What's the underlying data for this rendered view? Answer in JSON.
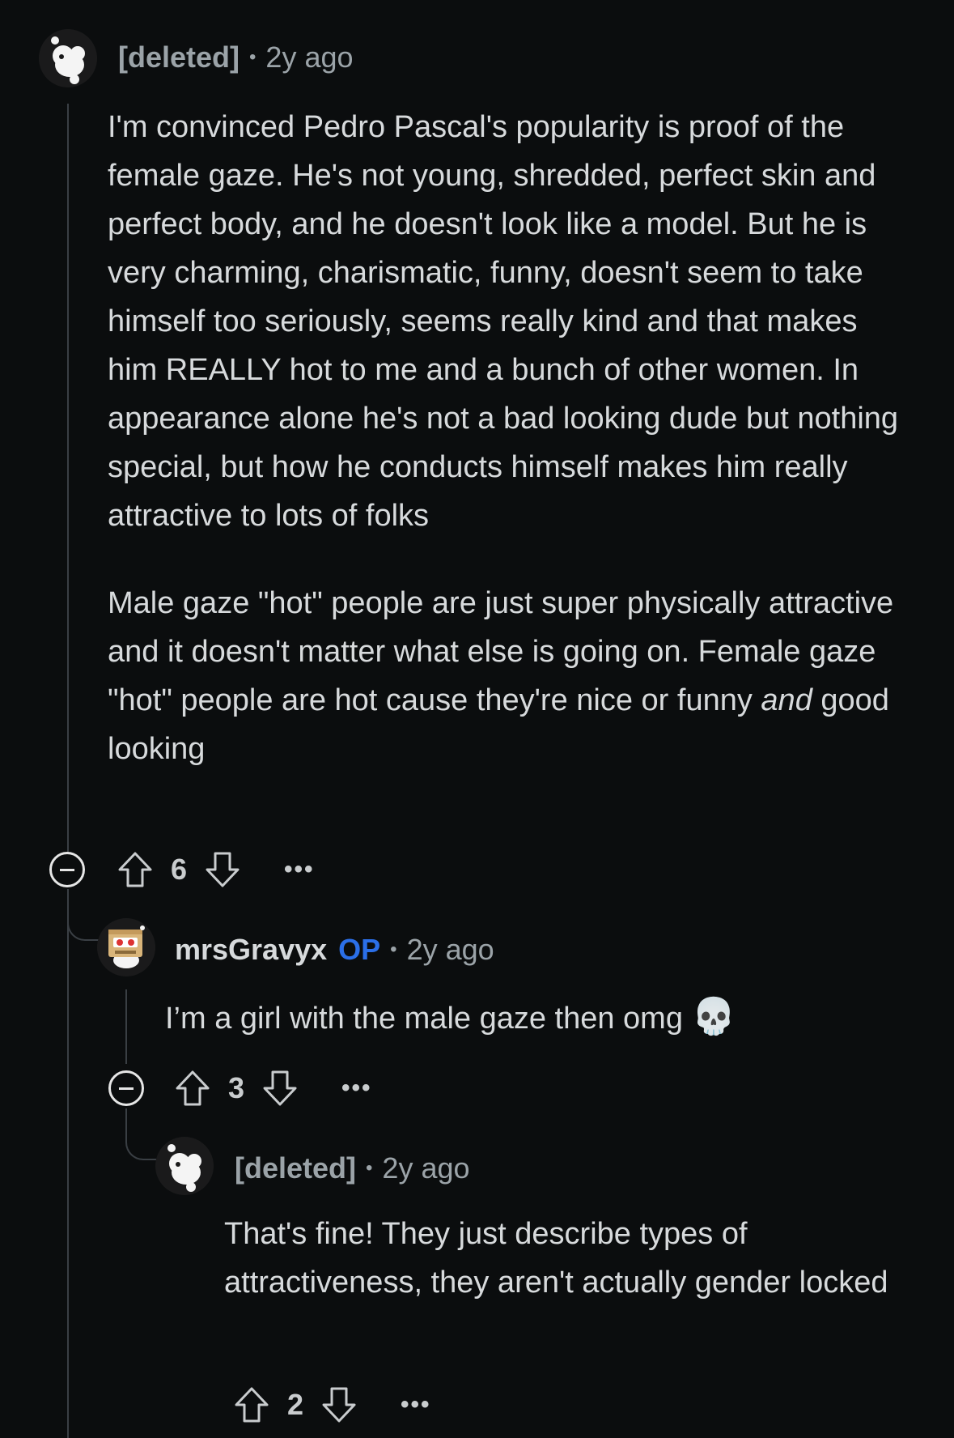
{
  "comments": [
    {
      "author": "[deleted]",
      "time": "2y ago",
      "paragraph_1": "I'm convinced Pedro Pascal's popularity is proof of the female gaze. He's not young, shredded, perfect skin and perfect body, and he doesn't look like a model. But he is very charming, charismatic, funny, doesn't seem to take himself too seriously, seems really kind and that makes him REALLY hot to me and a bunch of other women. In appearance alone he's not a bad looking dude but nothing special, but how he conducts himself makes him really attractive to lots of folks",
      "paragraph_2_start": "Male gaze \"hot\" people are just super physically attractive and it doesn't matter what else is going on. Female gaze \"hot\" people are hot cause they're nice or funny ",
      "paragraph_2_em": "and",
      "paragraph_2_end": " good looking",
      "score": "6",
      "more": "•••"
    },
    {
      "author": "mrsGravyx",
      "op_badge": "OP",
      "time": "2y ago",
      "text": "I’m a girl with the male gaze then omg",
      "emoji": "💀",
      "score": "3",
      "more": "•••"
    },
    {
      "author": "[deleted]",
      "time": "2y ago",
      "text": "That's fine! They just describe types of attractiveness, they aren't actually gender locked",
      "score": "2",
      "more": "•••"
    }
  ],
  "separator": "•",
  "icons": {
    "avatar_deleted": "snoo-avatar-icon",
    "avatar_user": "box-robot-avatar-icon",
    "collapse": "collapse-minus-icon",
    "upvote": "upvote-arrow-icon",
    "downvote": "downvote-arrow-icon",
    "more": "more-options-icon"
  },
  "colors": {
    "background": "#0b0d0e",
    "text": "#d7dadc",
    "meta": "#9ba3a8",
    "op_badge": "#2b6fe8",
    "thread_line": "#3a3f44"
  }
}
